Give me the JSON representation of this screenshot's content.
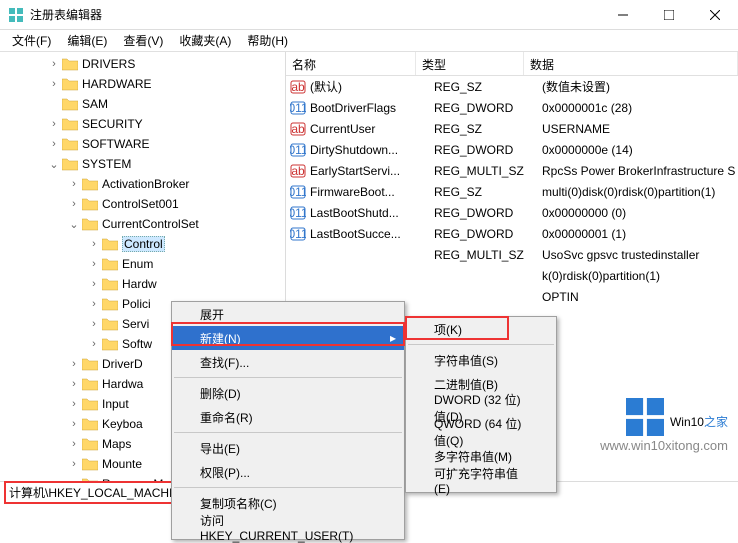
{
  "window": {
    "title": "注册表编辑器"
  },
  "winbuttons": {
    "min": "—",
    "max": "☐",
    "close": "✕"
  },
  "menu": [
    "文件(F)",
    "编辑(E)",
    "查看(V)",
    "收藏夹(A)",
    "帮助(H)"
  ],
  "tree": [
    {
      "indent": 48,
      "tgl": ">",
      "label": "DRIVERS"
    },
    {
      "indent": 48,
      "tgl": ">",
      "label": "HARDWARE"
    },
    {
      "indent": 48,
      "tgl": "",
      "label": "SAM"
    },
    {
      "indent": 48,
      "tgl": ">",
      "label": "SECURITY"
    },
    {
      "indent": 48,
      "tgl": ">",
      "label": "SOFTWARE"
    },
    {
      "indent": 48,
      "tgl": "v",
      "label": "SYSTEM"
    },
    {
      "indent": 68,
      "tgl": ">",
      "label": "ActivationBroker"
    },
    {
      "indent": 68,
      "tgl": ">",
      "label": "ControlSet001"
    },
    {
      "indent": 68,
      "tgl": "v",
      "label": "CurrentControlSet"
    },
    {
      "indent": 88,
      "tgl": ">",
      "label": "Control",
      "sel": true
    },
    {
      "indent": 88,
      "tgl": ">",
      "label": "Enum"
    },
    {
      "indent": 88,
      "tgl": ">",
      "label": "Hardw"
    },
    {
      "indent": 88,
      "tgl": ">",
      "label": "Polici"
    },
    {
      "indent": 88,
      "tgl": ">",
      "label": "Servi"
    },
    {
      "indent": 88,
      "tgl": ">",
      "label": "Softw"
    },
    {
      "indent": 68,
      "tgl": ">",
      "label": "DriverD"
    },
    {
      "indent": 68,
      "tgl": ">",
      "label": "Hardwa"
    },
    {
      "indent": 68,
      "tgl": ">",
      "label": "Input"
    },
    {
      "indent": 68,
      "tgl": ">",
      "label": "Keyboa"
    },
    {
      "indent": 68,
      "tgl": ">",
      "label": "Maps"
    },
    {
      "indent": 68,
      "tgl": ">",
      "label": "Mounte"
    },
    {
      "indent": 68,
      "tgl": ">",
      "label": "ResourceManager"
    }
  ],
  "columns": {
    "name": "名称",
    "type": "类型",
    "data": "数据"
  },
  "values": [
    {
      "icon": "str",
      "name": "(默认)",
      "type": "REG_SZ",
      "data": "(数值未设置)"
    },
    {
      "icon": "bin",
      "name": "BootDriverFlags",
      "type": "REG_DWORD",
      "data": "0x0000001c (28)"
    },
    {
      "icon": "str",
      "name": "CurrentUser",
      "type": "REG_SZ",
      "data": "USERNAME"
    },
    {
      "icon": "bin",
      "name": "DirtyShutdown...",
      "type": "REG_DWORD",
      "data": "0x0000000e (14)"
    },
    {
      "icon": "str",
      "name": "EarlyStartServi...",
      "type": "REG_MULTI_SZ",
      "data": "RpcSs Power BrokerInfrastructure S"
    },
    {
      "icon": "bin",
      "name": "FirmwareBoot...",
      "type": "REG_SZ",
      "data": "multi(0)disk(0)rdisk(0)partition(1)"
    },
    {
      "icon": "bin",
      "name": "LastBootShutd...",
      "type": "REG_DWORD",
      "data": "0x00000000 (0)"
    },
    {
      "icon": "bin",
      "name": "LastBootSucce...",
      "type": "REG_DWORD",
      "data": "0x00000001 (1)"
    },
    {
      "icon": "",
      "name": "",
      "type": "REG_MULTI_SZ",
      "data": "UsoSvc gpsvc trustedinstaller"
    },
    {
      "icon": "",
      "name": "",
      "type": "",
      "data": "k(0)rdisk(0)partition(1)"
    },
    {
      "icon": "",
      "name": "",
      "type": "",
      "data": "OPTIN"
    }
  ],
  "ctx1": [
    {
      "label": "展开",
      "dis": false
    },
    {
      "label": "新建(N)",
      "hl": true,
      "arrow": true
    },
    {
      "label": "查找(F)..."
    },
    {
      "sep": true
    },
    {
      "label": "删除(D)",
      "dis": true
    },
    {
      "label": "重命名(R)",
      "dis": true
    },
    {
      "sep": true
    },
    {
      "label": "导出(E)"
    },
    {
      "label": "权限(P)..."
    },
    {
      "sep": true
    },
    {
      "label": "复制项名称(C)"
    },
    {
      "label": "访问 HKEY_CURRENT_USER(T)"
    }
  ],
  "ctx2": [
    {
      "label": "项(K)"
    },
    {
      "sep": true
    },
    {
      "label": "字符串值(S)"
    },
    {
      "label": "二进制值(B)"
    },
    {
      "label": "DWORD (32 位)值(D)"
    },
    {
      "label": "QWORD (64 位)值(Q)"
    },
    {
      "label": "多字符串值(M)"
    },
    {
      "label": "可扩充字符串值(E)"
    }
  ],
  "status": {
    "path": "计算机\\HKEY_LOCAL_MACHINE\\SYSTEM\\CurrentControlSet\\Control"
  },
  "watermark": {
    "brand": "Win10",
    "suffix": "之家",
    "url": "www.win10xitong.com"
  }
}
